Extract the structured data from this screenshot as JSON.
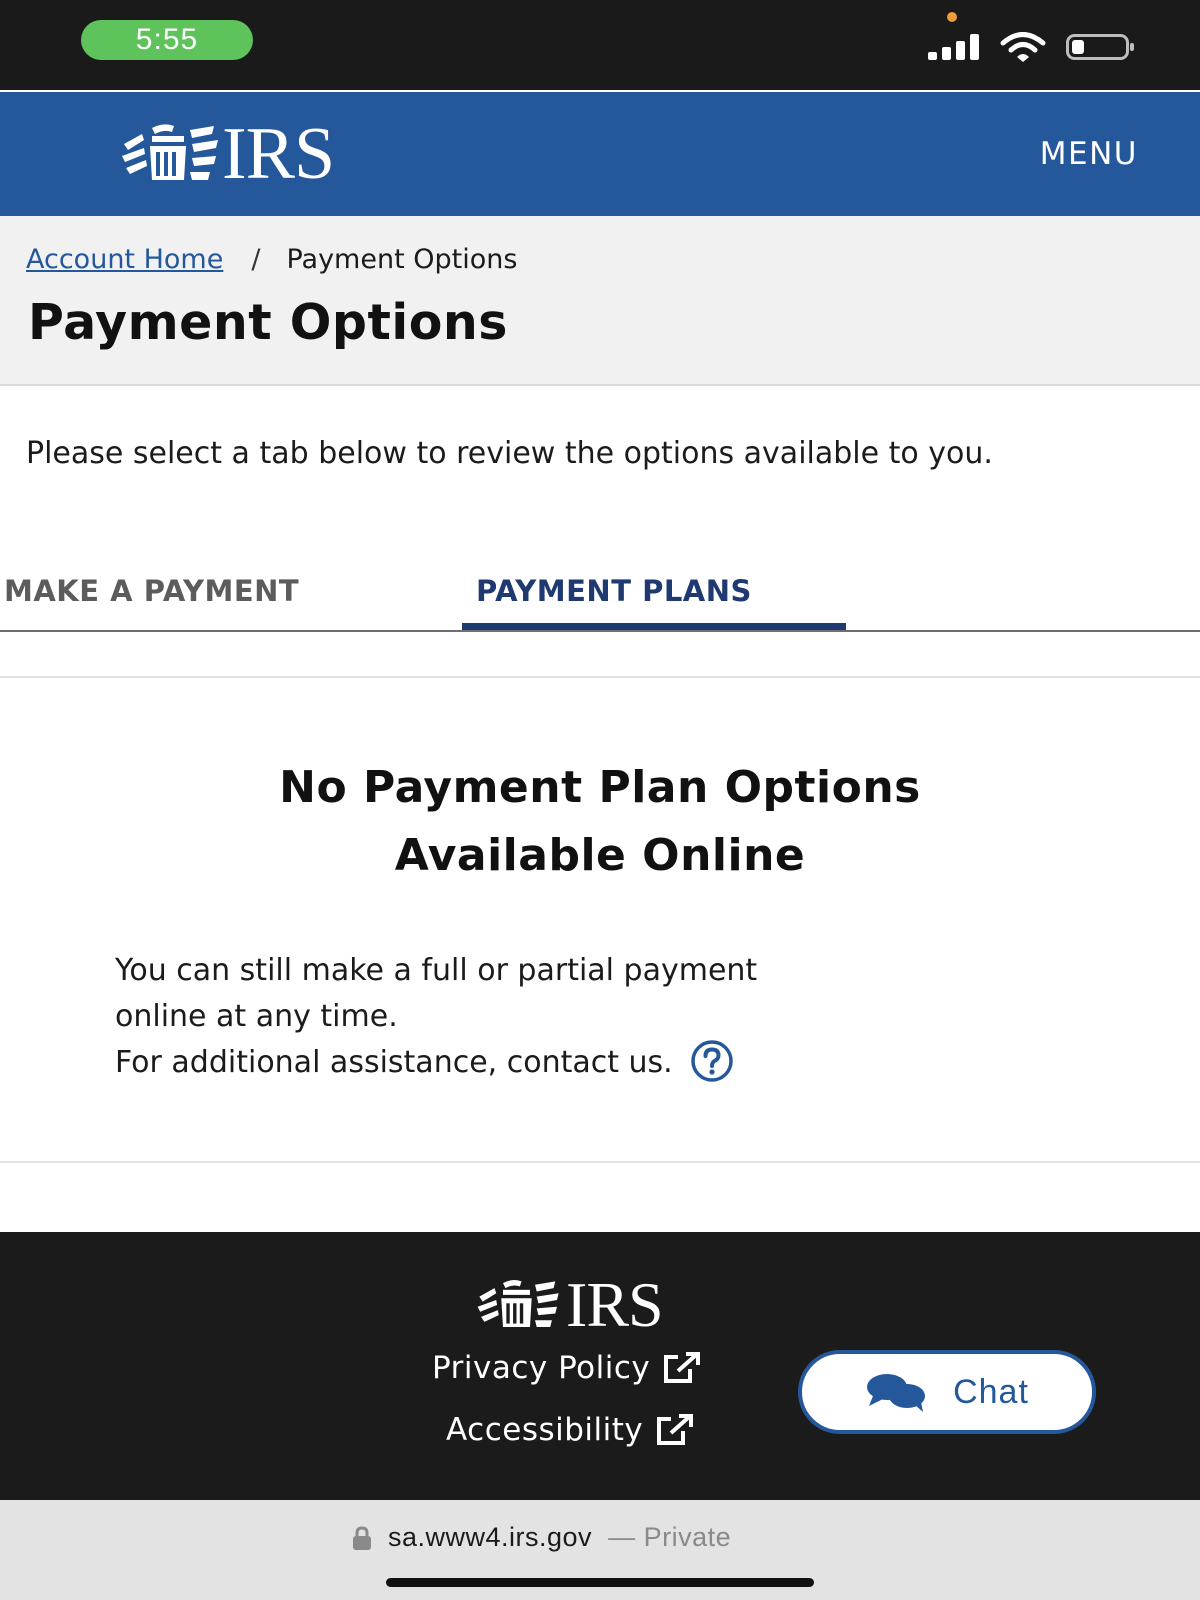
{
  "status_bar": {
    "time": "5:55"
  },
  "header": {
    "logo_text": "IRS",
    "menu_label": "MENU"
  },
  "breadcrumb": {
    "home": "Account Home",
    "separator": "/",
    "current": "Payment Options"
  },
  "page_title": "Payment Options",
  "intro_text": "Please select a tab below to review the options available to you.",
  "tabs": [
    {
      "label": "MAKE A PAYMENT",
      "selected": false
    },
    {
      "label": "PAYMENT PLANS",
      "selected": true
    }
  ],
  "notice": {
    "title_line1": "No Payment Plan Options",
    "title_line2": "Available Online",
    "body_line1": "You can still make a full or partial payment",
    "body_line2": "online at any time.",
    "body_line3": "For additional assistance, contact us."
  },
  "footer": {
    "logo_text": "IRS",
    "privacy_label": "Privacy Policy",
    "accessibility_label": "Accessibility"
  },
  "chat": {
    "label": "Chat"
  },
  "browser": {
    "url": "sa.www4.irs.gov",
    "private_label": "— Private"
  },
  "icons": {
    "help": "question-circle-icon",
    "external": "external-link-icon",
    "chat": "chat-bubbles-icon",
    "lock": "lock-icon"
  },
  "colors": {
    "header_blue": "#25589b",
    "tab_active": "#1f3a70",
    "footer_bg": "#1b1b1b",
    "status_pill": "#5ec35a"
  }
}
